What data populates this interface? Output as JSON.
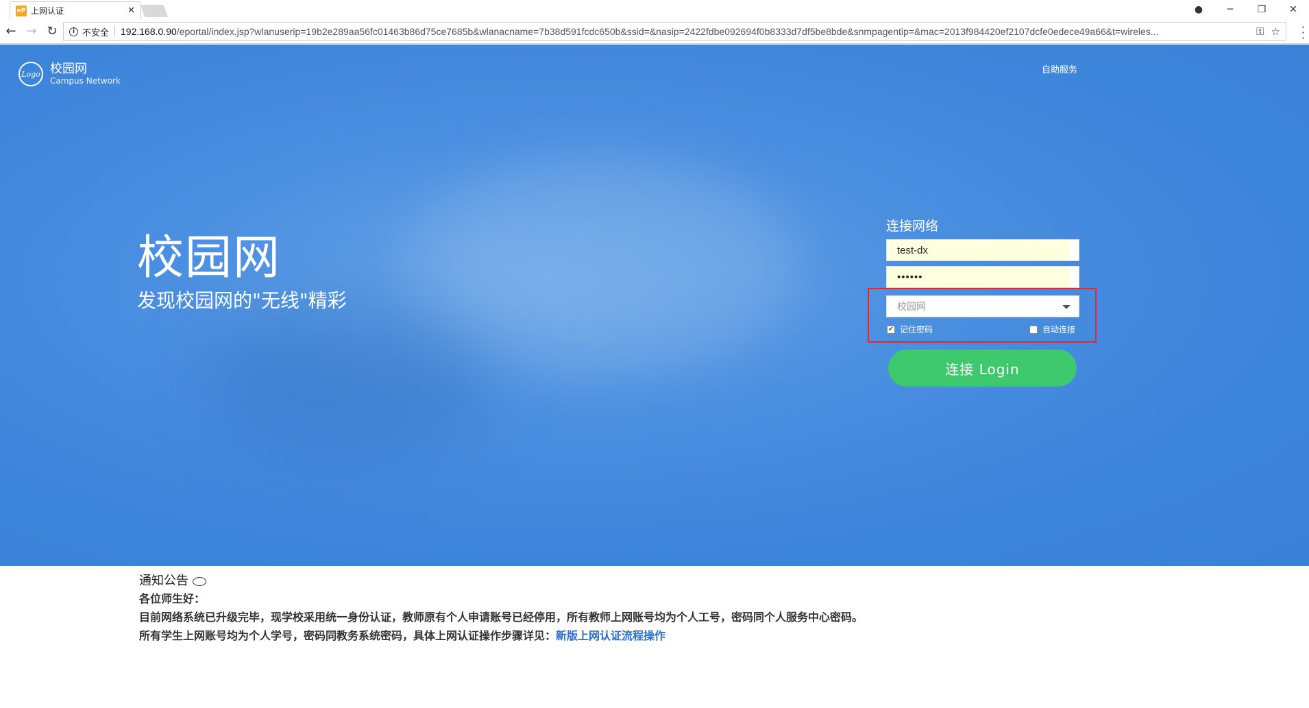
{
  "browser": {
    "tab_title": "上网认证",
    "tab_favicon_text": "eP",
    "security_label": "不安全",
    "url_host": "192.168.0.90",
    "url_path": "/eportal/index.jsp?wlanuserip=19b2e289aa56fc01463b86d75ce7685b&wlanacname=7b38d591fcdc650b&ssid=&nasip=2422fdbe092694f0b8333d7df5be8bde&snmpagentip=&mac=2013f984420ef2107dcfe0edece49a66&t=wireles..."
  },
  "header": {
    "logo_mark": "Logo",
    "logo_cn": "校园网",
    "logo_en": "Campus Network",
    "self_service": "自助服务"
  },
  "hero": {
    "title": "校园网",
    "subtitle": "发现校园网的\"无线\"精彩"
  },
  "login": {
    "title": "连接网络",
    "username_value": "test-dx",
    "password_value": "••••••",
    "service_select_value": "校园网",
    "remember_label": "记住密码",
    "remember_checked": true,
    "auto_connect_label": "自动连接",
    "auto_connect_checked": false,
    "button_label": "连接 Login"
  },
  "notice": {
    "title": "通知公告",
    "greeting": "各位师生好：",
    "line1": "目前网络系统已升级完毕，现学校采用统一身份认证，教师原有个人申请账号已经停用，所有教师上网账号均为个人工号，密码同个人服务中心密码。",
    "line2_prefix": "所有学生上网账号均为个人学号，密码同教务系统密码，具体上网认证操作步骤详见：",
    "line2_link": "新版上网认证流程操作"
  },
  "colors": {
    "hero_blue": "#3d84db",
    "login_green": "#3ec96e",
    "highlight_red": "#e0282e",
    "link_blue": "#2a6fcc"
  }
}
